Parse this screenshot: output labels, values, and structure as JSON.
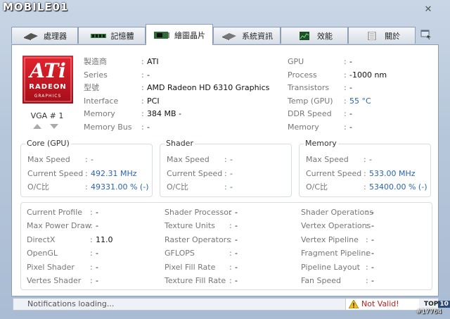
{
  "watermark": {
    "brand": "MOBILE01",
    "post_id": "#17764"
  },
  "window": {
    "close_glyph": "✕"
  },
  "tabs": [
    {
      "label": "處理器",
      "icon": "cpu-icon"
    },
    {
      "label": "記憶體",
      "icon": "ram-icon"
    },
    {
      "label": "繪圖晶片",
      "icon": "gpu-card-icon",
      "active": true
    },
    {
      "label": "系統資訊",
      "icon": "system-icon"
    },
    {
      "label": "效能",
      "icon": "performance-icon"
    },
    {
      "label": "關於",
      "icon": "about-icon"
    }
  ],
  "gpu": {
    "logo_text": "ATi",
    "logo_sub": "RADEON",
    "logo_sub2": "GRAPHICS",
    "vga": "VGA # 1",
    "left": [
      {
        "label": "製造商",
        "value": "ATI"
      },
      {
        "label": "Series",
        "value": "-"
      },
      {
        "label": "型號",
        "value": "AMD Radeon HD 6310 Graphics"
      },
      {
        "label": "Interface",
        "value": "PCI"
      },
      {
        "label": "Memory",
        "value": "384 MB -"
      },
      {
        "label": "Memory Bus",
        "value": "-"
      }
    ],
    "right": [
      {
        "label": "GPU",
        "value": "-"
      },
      {
        "label": "Process",
        "value": "-1000 nm"
      },
      {
        "label": "Transistors",
        "value": "-"
      },
      {
        "label": "Temp (GPU)",
        "value": "55 °C"
      },
      {
        "label": "DDR Speed",
        "value": "-"
      },
      {
        "label": "Memory",
        "value": "-"
      }
    ]
  },
  "groups": [
    {
      "title": "Core (GPU)",
      "rows": [
        {
          "label": "Max Speed",
          "value": "-"
        },
        {
          "label": "Current Speed",
          "value": "492.31 MHz"
        },
        {
          "label": "O/C比",
          "value": "49331.00 % (-)"
        }
      ]
    },
    {
      "title": "Shader",
      "rows": [
        {
          "label": "Max Speed",
          "value": "-"
        },
        {
          "label": "Current Speed",
          "value": "-"
        },
        {
          "label": "O/C比",
          "value": "-"
        }
      ]
    },
    {
      "title": "Memory",
      "rows": [
        {
          "label": "Max Speed",
          "value": "-"
        },
        {
          "label": "Current Speed",
          "value": "533.00 MHz"
        },
        {
          "label": "O/C比",
          "value": "53400.00 % (-)"
        }
      ]
    }
  ],
  "details": {
    "col1": [
      {
        "label": "Current Profile",
        "value": "-"
      },
      {
        "label": "Max Power Draw",
        "value": "-"
      },
      {
        "label": "DirectX",
        "value": "11.0"
      },
      {
        "label": "OpenGL",
        "value": "-"
      },
      {
        "label": "Pixel Shader",
        "value": "-"
      },
      {
        "label": "Vertes Shader",
        "value": "-"
      }
    ],
    "col2": [
      {
        "label": "Shader Processor",
        "value": "-"
      },
      {
        "label": "Texture Units",
        "value": "-"
      },
      {
        "label": "Raster Operators",
        "value": "-"
      },
      {
        "label": "GFLOPS",
        "value": "-"
      },
      {
        "label": "Pixel Fill Rate",
        "value": "-"
      },
      {
        "label": "Texture Fill Rate",
        "value": "-"
      }
    ],
    "col3": [
      {
        "label": "Shader Operations",
        "value": "-"
      },
      {
        "label": "Vertex Operations",
        "value": "-"
      },
      {
        "label": "Vertex Pipeline",
        "value": "-"
      },
      {
        "label": "Fragment Pipeline",
        "value": "-"
      },
      {
        "label": "Pipeline Layout",
        "value": "-"
      },
      {
        "label": "Fan Speed",
        "value": "-"
      }
    ]
  },
  "status": {
    "notification": "Notifications loading...",
    "validity": "Not Valid!",
    "badge_a": "TOP",
    "badge_b": "10"
  },
  "colors": {
    "accent_blue": "#2a63b3",
    "ati_red": "#c8102e",
    "invalid_red": "#c81b1b"
  }
}
